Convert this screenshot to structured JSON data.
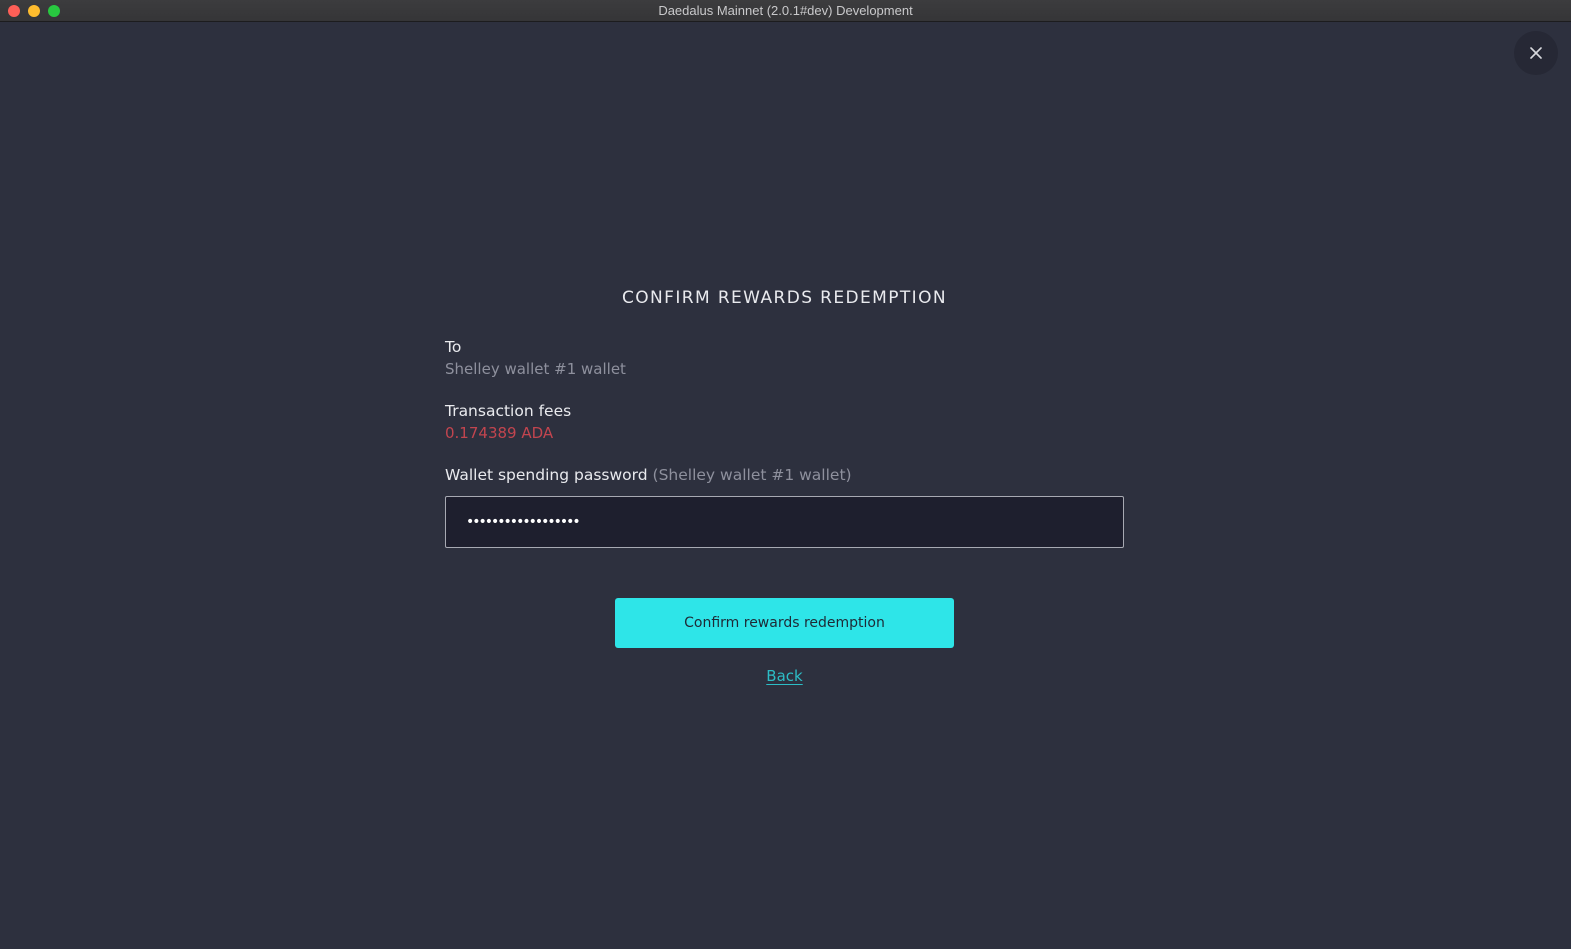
{
  "window": {
    "title": "Daedalus Mainnet (2.0.1#dev) Development",
    "traffic_lights": {
      "close_color": "#fe5f57",
      "minimize_color": "#febc2e",
      "zoom_color": "#28c840"
    }
  },
  "close_icon": "close-icon",
  "dialog": {
    "title": "CONFIRM REWARDS REDEMPTION",
    "to_label": "To",
    "to_value": "Shelley wallet #1 wallet",
    "fees_label": "Transaction fees",
    "fees_value": "0.174389 ADA",
    "fees_color": "#c2454f",
    "password_label": "Wallet spending password",
    "password_hint": "(Shelley wallet #1 wallet)",
    "password_value": "••••••••••••••••••",
    "confirm_label": "Confirm rewards redemption",
    "confirm_color": "#2ee5e8",
    "back_label": "Back",
    "back_color": "#2cbdc6"
  }
}
